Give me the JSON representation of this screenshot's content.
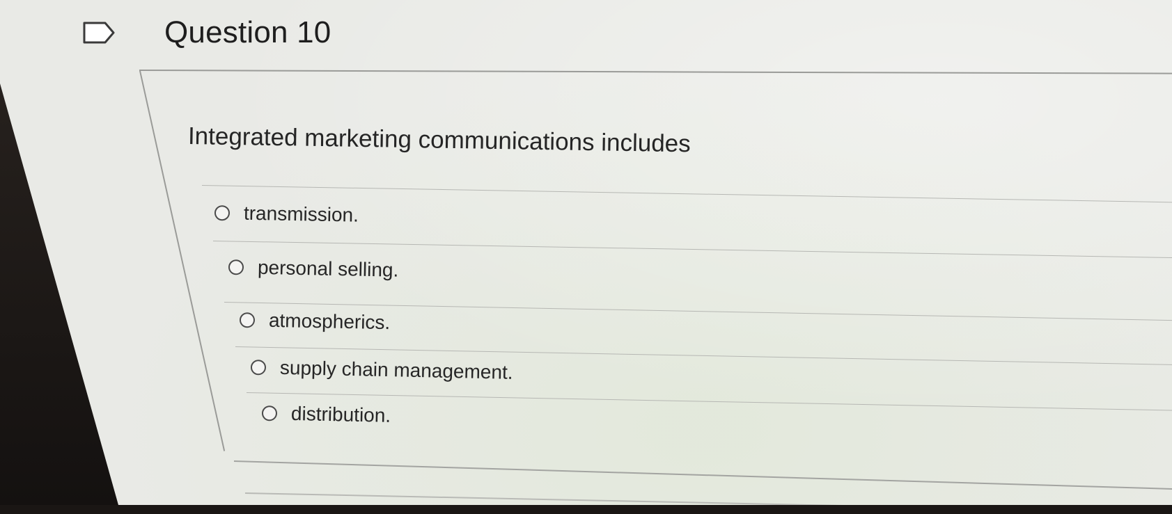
{
  "question": {
    "title": "Question 10",
    "flag_icon": "flag-outline-icon",
    "prompt": "Integrated marketing communications includes",
    "options": [
      {
        "label": "transmission.",
        "selected": false
      },
      {
        "label": "personal selling.",
        "selected": false
      },
      {
        "label": "atmospherics.",
        "selected": false
      },
      {
        "label": "supply chain management.",
        "selected": false
      },
      {
        "label": "distribution.",
        "selected": false
      }
    ]
  },
  "colors": {
    "page_background": "#e9eae6",
    "text": "#262626",
    "rule": "#9a9b98"
  }
}
